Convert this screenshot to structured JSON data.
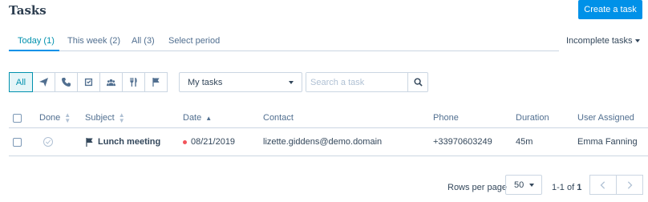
{
  "header": {
    "title": "Tasks",
    "create_button": "Create a task"
  },
  "tabs": [
    {
      "label": "Today (1)",
      "active": true
    },
    {
      "label": "This week (2)",
      "active": false
    },
    {
      "label": "All (3)",
      "active": false
    },
    {
      "label": "Select period",
      "active": false
    }
  ],
  "status_filter": {
    "value": "Incomplete tasks"
  },
  "type_filters": [
    {
      "label": "All",
      "active": true
    },
    {
      "icon": "send-icon"
    },
    {
      "icon": "phone-icon"
    },
    {
      "icon": "checkbox-icon"
    },
    {
      "icon": "meeting-icon"
    },
    {
      "icon": "lunch-icon"
    },
    {
      "icon": "flag-icon"
    }
  ],
  "owner_filter": {
    "value": "My tasks"
  },
  "search": {
    "placeholder": "Search a task"
  },
  "table": {
    "columns": [
      "Done",
      "Subject",
      "Date",
      "Contact",
      "Phone",
      "Duration",
      "User Assigned"
    ],
    "rows": [
      {
        "subject": "Lunch meeting",
        "subject_icon": "flag-icon",
        "date": "08/21/2019",
        "contact": "lizette.giddens@demo.domain",
        "phone": "+33970603249",
        "duration": "45m",
        "user": "Emma Fanning",
        "date_status_color": "#f2545b"
      }
    ]
  },
  "pagination": {
    "rows_per_page_label": "Rows per page",
    "rows_per_page": "50",
    "range_prefix": "1-1 of ",
    "range_total": "1"
  },
  "colors": {
    "accent": "#0091e8",
    "border": "#cbd6e2",
    "text": "#33475b"
  }
}
